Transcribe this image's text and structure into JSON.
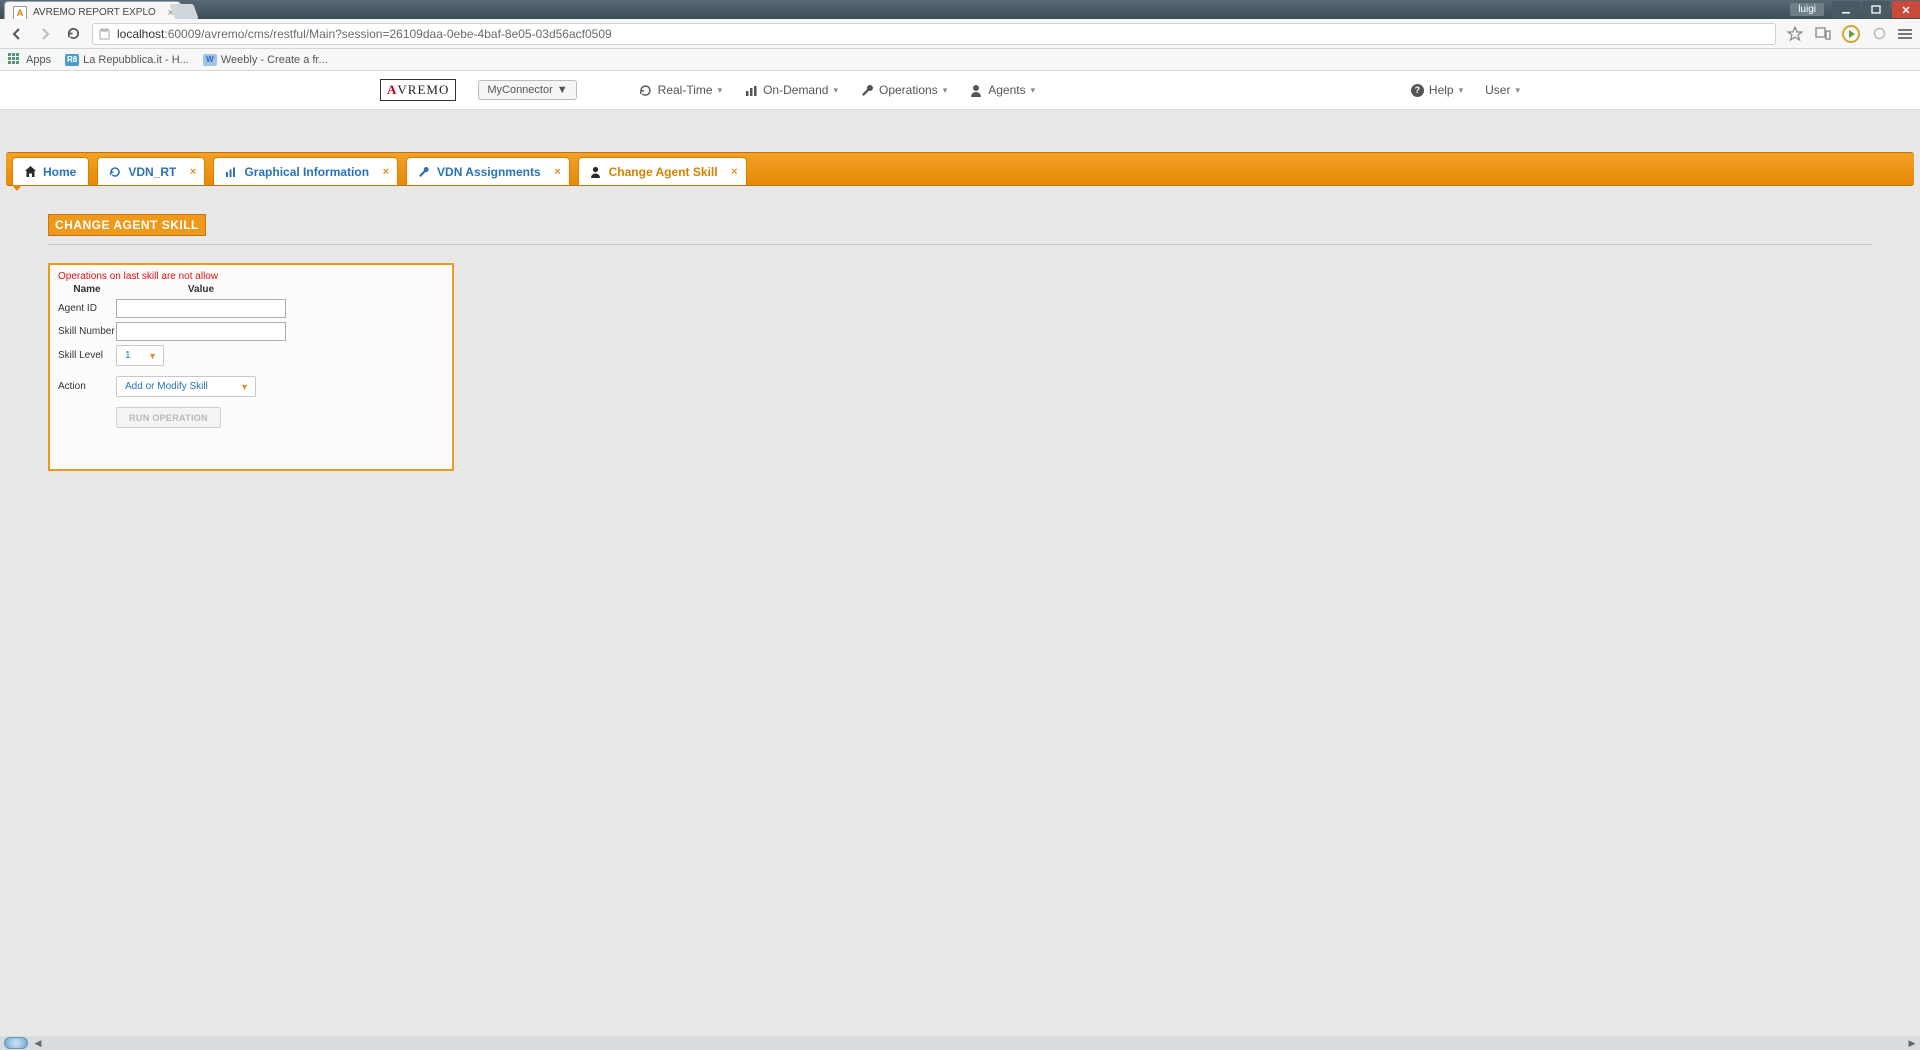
{
  "window": {
    "title_center": "",
    "user_pill": "luigi"
  },
  "browser": {
    "tab_title": "AVREMO REPORT EXPLO",
    "url_host": "localhost",
    "url_port": ":60009",
    "url_path": "/avremo/cms/restful/Main?session=26109daa-0ebe-4baf-8e05-03d56acf0509"
  },
  "bookmarks": {
    "apps": "Apps",
    "rep": "La Repubblica.it - H...",
    "weebly": "Weebly - Create a fr..."
  },
  "app_header": {
    "logo_a": "A",
    "logo_rest": "VREMO",
    "connector": "MyConnector",
    "menus": {
      "realtime": "Real-Time",
      "ondemand": "On-Demand",
      "operations": "Operations",
      "agents": "Agents"
    },
    "right": {
      "help": "Help",
      "user": "User"
    }
  },
  "tabs": {
    "home": "Home",
    "vdn_rt": "VDN_RT",
    "graph": "Graphical Information",
    "vdn_assign": "VDN Assignments",
    "change_skill": "Change Agent Skill"
  },
  "section": {
    "title": "CHANGE AGENT SKILL"
  },
  "form": {
    "warn": "Operations on last skill are not allow",
    "hdr_name": "Name",
    "hdr_value": "Value",
    "agent_id": {
      "label": "Agent ID",
      "value": ""
    },
    "skill_number": {
      "label": "Skill Number",
      "value": ""
    },
    "skill_level": {
      "label": "Skill Level",
      "selected": "1"
    },
    "action": {
      "label": "Action",
      "selected": "Add or Modify Skill"
    },
    "run": "RUN OPERATION"
  }
}
